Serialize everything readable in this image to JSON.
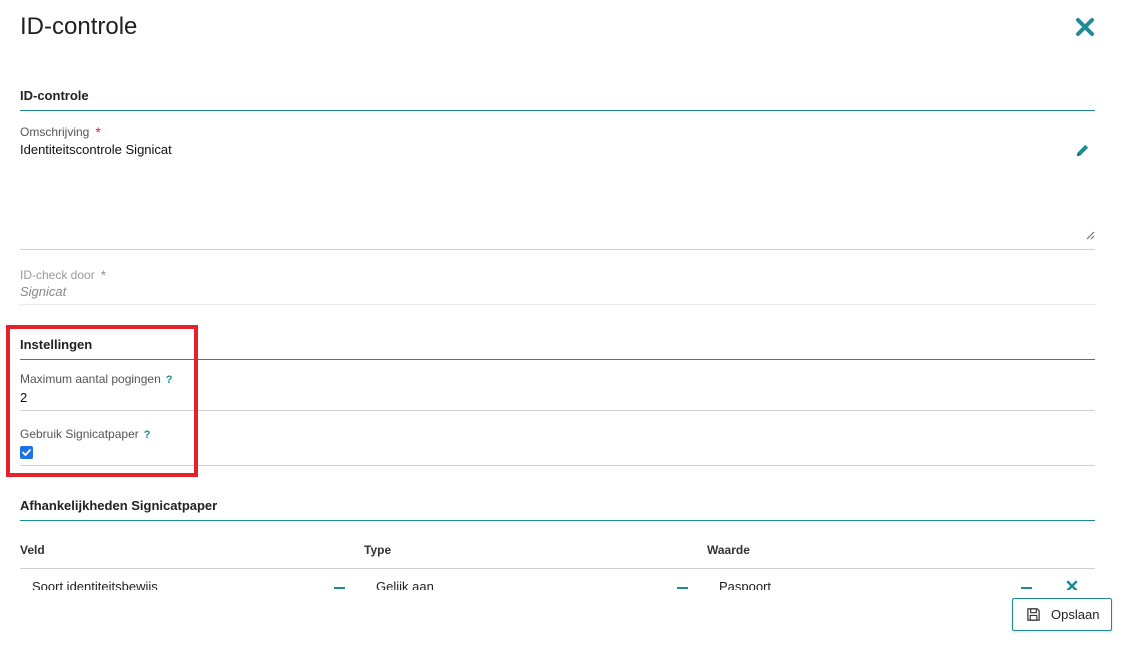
{
  "page": {
    "title": "ID-controle",
    "close_icon": "close-icon"
  },
  "colors": {
    "accent": "#1d8a95",
    "required": "#d9262e",
    "highlight": "#e3222d",
    "checkbox": "#1a73e8"
  },
  "section_idcontrole": {
    "header": "ID-controle",
    "omschrijving": {
      "label": "Omschrijving",
      "required_mark": "*",
      "value": "Identiteitscontrole Signicat"
    },
    "idcheck": {
      "label": "ID-check door",
      "required_mark": "*",
      "value": "Signicat"
    }
  },
  "section_instellingen": {
    "header": "Instellingen",
    "max_pogingen": {
      "label": "Maximum aantal pogingen",
      "help": "?",
      "value": "2"
    },
    "signicatpaper": {
      "label": "Gebruik Signicatpaper",
      "help": "?",
      "checked": true
    }
  },
  "section_afhankelijkheden": {
    "header": "Afhankelijkheden Signicatpaper",
    "columns": [
      "Veld",
      "Type",
      "Waarde"
    ],
    "rows": [
      {
        "veld": "Soort identiteitsbewijs",
        "type": "Gelijk aan",
        "waarde": "Paspoort"
      }
    ]
  },
  "footer": {
    "save_label": "Opslaan",
    "save_icon": "save-icon"
  }
}
